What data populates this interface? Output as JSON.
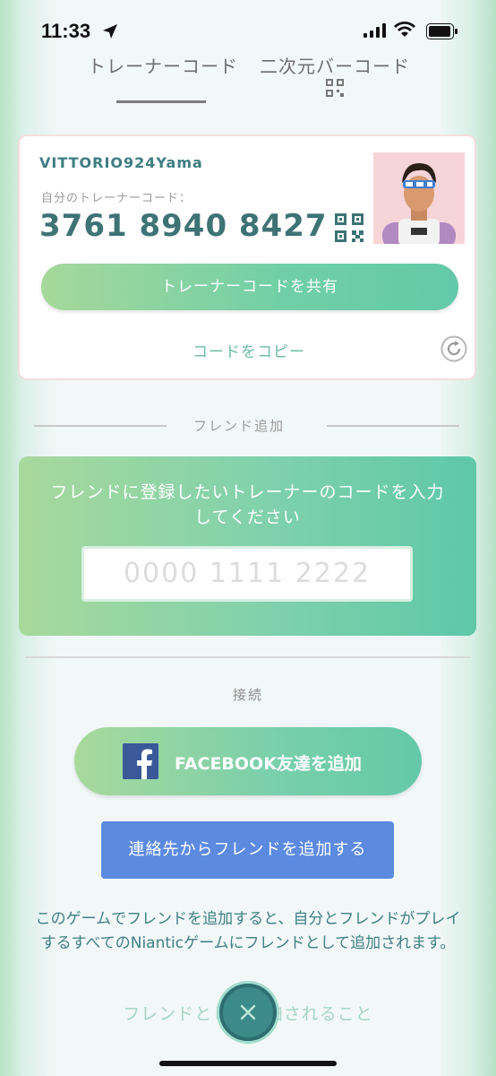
{
  "status_bar": {
    "time": "11:33"
  },
  "tabs": {
    "trainer_code": "トレーナーコード",
    "qr_code": "二次元バーコード"
  },
  "profile_card": {
    "username": "VITTORIO924Yama",
    "code_label": "自分のトレーナーコード：",
    "code_value": "3761 8940 8427",
    "share_button": "トレーナーコードを共有",
    "copy_link": "コードをコピー"
  },
  "add_friend": {
    "section_title": "フレンド追加",
    "prompt": "フレンドに登録したいトレーナーのコードを入力してください",
    "input_placeholder": "0000 1111 2222"
  },
  "connect": {
    "section_title": "接続",
    "facebook_button": "FACEBOOK友達を追加",
    "contacts_button": "連絡先からフレンドを追加する",
    "info_text": "このゲームでフレンドを追加すると、自分とフレンドがプレイするすべてのNianticゲームにフレンドとして追加されます。",
    "bottom_link": "フレンドとして追加されること"
  },
  "colors": {
    "accent_green": "#6fcfa8",
    "text_teal": "#3e7375",
    "contacts_blue": "#5b8ae0",
    "facebook_blue": "#3b5998"
  },
  "icons": [
    "location-arrow-icon",
    "signal-icon",
    "wifi-icon",
    "battery-icon",
    "qr-code-icon",
    "refresh-icon",
    "facebook-icon",
    "close-icon"
  ]
}
